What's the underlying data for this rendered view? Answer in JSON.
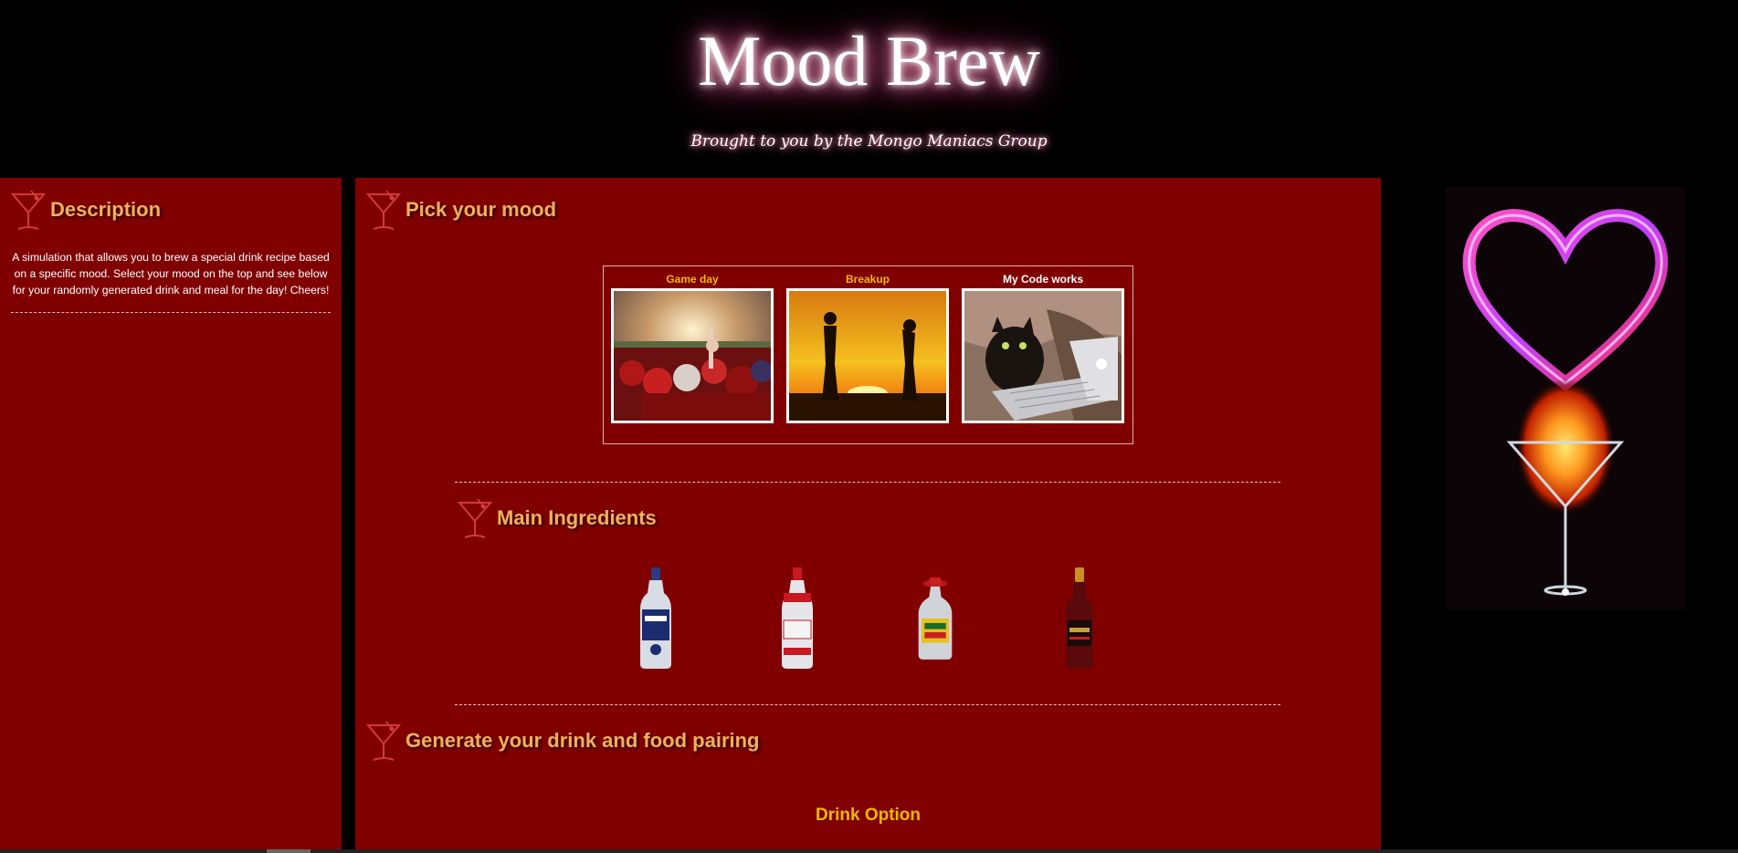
{
  "header": {
    "title": "Mood Brew",
    "subtitle": "Brought to you by the Mongo Maniacs Group"
  },
  "sidebar": {
    "heading": "Description",
    "text": "A simulation that allows you to brew a special drink recipe based on a specific mood. Select your mood on the top and see below for your randomly generated drink and meal for the day! Cheers!"
  },
  "main": {
    "mood_heading": "Pick your mood",
    "moods": [
      {
        "label": "Game day",
        "color": "#f0b800"
      },
      {
        "label": "Breakup",
        "color": "#f0b800"
      },
      {
        "label": "My Code works",
        "color": "#ffffff"
      }
    ],
    "ingredients_heading": "Main Ingredients",
    "ingredients": [
      "vodka-bottle-blue",
      "vodka-bottle-red",
      "tequila-bottle",
      "rum-bottle"
    ],
    "generate_heading": "Generate your drink and food pairing",
    "drink_option_label": "Drink Option"
  },
  "colors": {
    "panel": "#800000",
    "heading": "#f0b05c",
    "accent": "#f0b800",
    "background": "#000000"
  }
}
